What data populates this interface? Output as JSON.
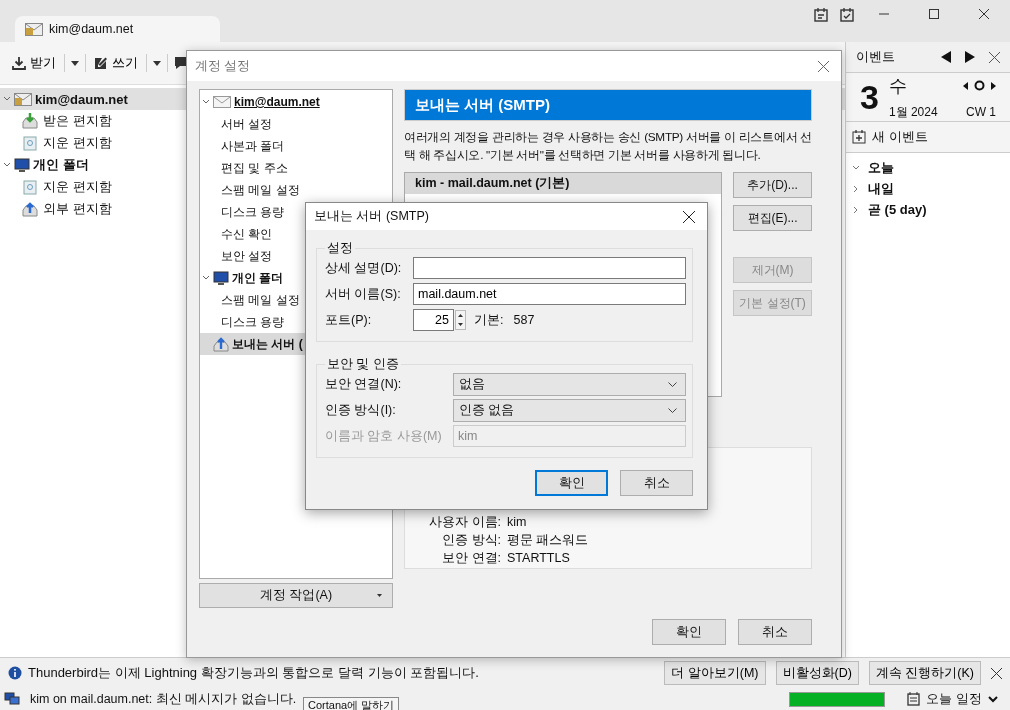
{
  "window": {
    "tab": "kim@daum.net",
    "toolbar": [
      {
        "label": "받기",
        "kind": "get"
      },
      {
        "label": "쓰기",
        "kind": "write"
      }
    ]
  },
  "folders": [
    {
      "label": "kim@daum.net",
      "kind": "account",
      "expanded": true,
      "selected": true,
      "children": [
        {
          "label": "받은 편지함",
          "kind": "inbox",
          "selected": false
        },
        {
          "label": "지운 편지함",
          "kind": "trash",
          "selected": false
        }
      ]
    },
    {
      "label": "개인 폴더",
      "kind": "local",
      "expanded": true,
      "selected": false,
      "children": [
        {
          "label": "지운 편지함",
          "kind": "trash",
          "selected": false
        },
        {
          "label": "외부 편지함",
          "kind": "outbox",
          "selected": false
        }
      ]
    }
  ],
  "account_settings": {
    "title": "계정 설정",
    "tree": [
      {
        "label": "kim@daum.net",
        "kind": "account",
        "expanded": true,
        "selected": false,
        "children": [
          {
            "label": "서버 설정",
            "selected": false
          },
          {
            "label": "사본과 폴더",
            "selected": false
          },
          {
            "label": "편집 및 주소",
            "selected": false
          },
          {
            "label": "스팸 메일 설정",
            "selected": false
          },
          {
            "label": "디스크 용량",
            "selected": false
          },
          {
            "label": "수신 확인",
            "selected": false
          },
          {
            "label": "보안 설정",
            "selected": false
          }
        ]
      },
      {
        "label": "개인 폴더",
        "kind": "local",
        "expanded": true,
        "selected": false,
        "children": [
          {
            "label": "스팸 메일 설정",
            "selected": false
          },
          {
            "label": "디스크 용량",
            "selected": false
          }
        ]
      },
      {
        "label": "보내는 서버 (",
        "kind": "smtp",
        "selected": true
      }
    ],
    "account_actions": "계정 작업(A)",
    "heading": "보내는 서버 (SMTP)",
    "description": "여러개의 계정을 관리하는 경우 사용하는 송신 (SMTP) 서버를 이 리스트에서 선택 해 주십시오. \"기본 서버\"를 선택하면 기본 서버를 사용하게 됩니다.",
    "servers": [
      {
        "label": "kim - mail.daum.net (기본)",
        "selected": true
      }
    ],
    "side_buttons": [
      {
        "label": "추가(D)...",
        "disabled": false
      },
      {
        "label": "편집(E)...",
        "disabled": false
      },
      {
        "label": "제거(M)",
        "disabled": true
      },
      {
        "label": "기본 설정(T)",
        "disabled": true
      }
    ],
    "details": [
      {
        "label": "사용자 이름:",
        "value": "kim"
      },
      {
        "label": "인증 방식:",
        "value": "평문 패스워드"
      },
      {
        "label": "보안 연결:",
        "value": "STARTTLS"
      }
    ],
    "buttons": [
      "확인",
      "취소"
    ]
  },
  "smtp_dialog": {
    "title": "보내는 서버 (SMTP)",
    "settings_group": "설정",
    "fields": [
      {
        "label": "상세 설명(D):"
      },
      {
        "label": "서버 이름(S):",
        "value": "mail.daum.net"
      }
    ],
    "port": {
      "label": "포트(P):",
      "value": "25",
      "default_label": "기본:",
      "default_value": "587"
    },
    "security_group": "보안 및 인증",
    "security": [
      {
        "label": "보안 연결(N):",
        "value": "없음",
        "kind": "select",
        "disabled": false
      },
      {
        "label": "인증 방식(I):",
        "value": "인증 없음",
        "kind": "select",
        "disabled": false
      },
      {
        "label": "이름과 암호 사용(M)",
        "value": "kim",
        "kind": "text",
        "disabled": true
      }
    ],
    "buttons": [
      {
        "label": "확인",
        "default": true
      },
      {
        "label": "취소",
        "default": false
      }
    ]
  },
  "events": {
    "title": "이벤트",
    "day": "3",
    "weekday": "수",
    "month_year": "1월 2024",
    "week": "CW 1",
    "new_event": "새 이벤트",
    "groups": [
      {
        "label": "오늘",
        "expanded": true
      },
      {
        "label": "내일",
        "expanded": false
      },
      {
        "label": "곧 (5 day)",
        "expanded": false
      }
    ]
  },
  "notification": {
    "text": "Thunderbird는 이제 Lightning 확장기능과의 통합으로 달력 기능이 포함됩니다.",
    "buttons": [
      "더 알아보기(M)",
      "비활성화(D)",
      "계속 진행하기(K)"
    ]
  },
  "status_bar": {
    "text": "kim on mail.daum.net: 최신 메시지가 없습니다.",
    "tooltip": "Cortana에 말하기",
    "level": 1,
    "today_pane": "오늘 일정"
  }
}
